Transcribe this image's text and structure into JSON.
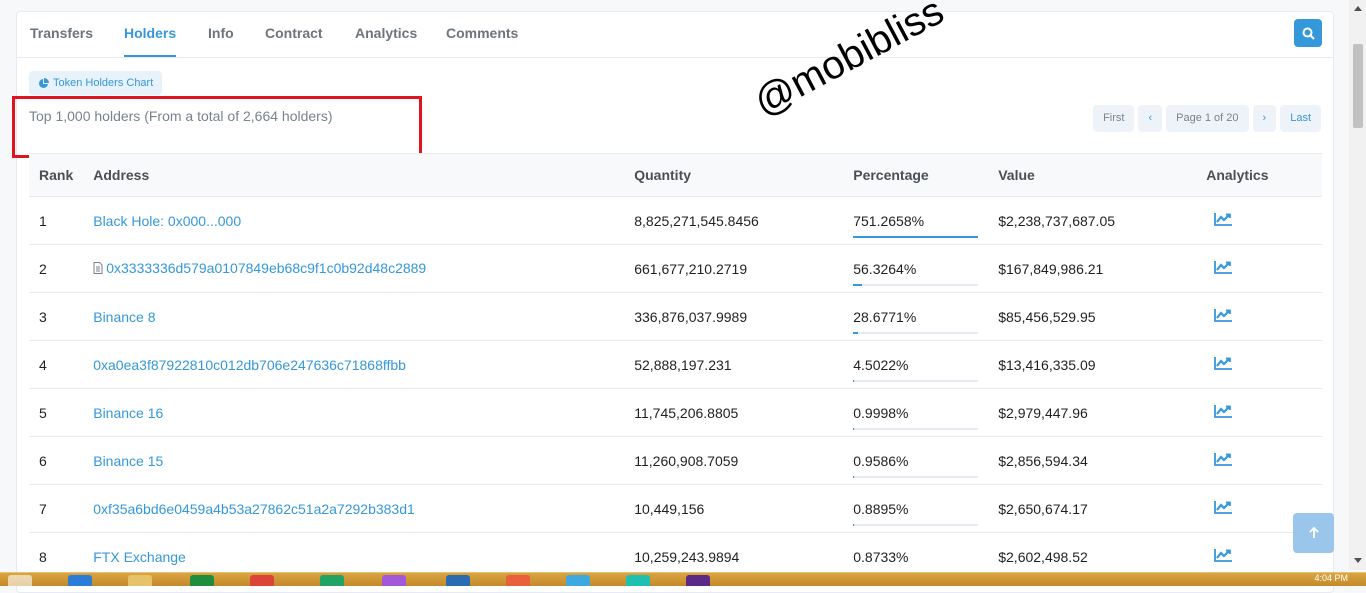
{
  "tabs": [
    {
      "label": "Transfers",
      "active": false
    },
    {
      "label": "Holders",
      "active": true
    },
    {
      "label": "Info",
      "active": false
    },
    {
      "label": "Contract",
      "active": false
    },
    {
      "label": "Analytics",
      "active": false
    },
    {
      "label": "Comments",
      "active": false
    }
  ],
  "chart_button_label": "Token Holders Chart",
  "summary": "Top 1,000 holders (From a total of 2,664 holders)",
  "watermark": "@mobibliss",
  "pagination": {
    "first": "First",
    "prev": "‹",
    "page_label": "Page 1 of 20",
    "next": "›",
    "last": "Last"
  },
  "table": {
    "headers": [
      "Rank",
      "Address",
      "Quantity",
      "Percentage",
      "Value",
      "Analytics"
    ],
    "rows": [
      {
        "rank": "1",
        "address": "Black Hole: 0x000...000",
        "is_contract": false,
        "quantity": "8,825,271,545.8456",
        "percentage": "751.2658%",
        "pct_fill": 1.0,
        "value": "$2,238,737,687.05"
      },
      {
        "rank": "2",
        "address": "0x3333336d579a0107849eb68c9f1c0b92d48c2889",
        "is_contract": true,
        "quantity": "661,677,210.2719",
        "percentage": "56.3264%",
        "pct_fill": 0.07,
        "value": "$167,849,986.21"
      },
      {
        "rank": "3",
        "address": "Binance 8",
        "is_contract": false,
        "quantity": "336,876,037.9989",
        "percentage": "28.6771%",
        "pct_fill": 0.04,
        "value": "$85,456,529.95"
      },
      {
        "rank": "4",
        "address": "0xa0ea3f87922810c012db706e247636c71868ffbb",
        "is_contract": false,
        "quantity": "52,888,197.231",
        "percentage": "4.5022%",
        "pct_fill": 0.01,
        "value": "$13,416,335.09"
      },
      {
        "rank": "5",
        "address": "Binance 16",
        "is_contract": false,
        "quantity": "11,745,206.8805",
        "percentage": "0.9998%",
        "pct_fill": 0.005,
        "value": "$2,979,447.96"
      },
      {
        "rank": "6",
        "address": "Binance 15",
        "is_contract": false,
        "quantity": "11,260,908.7059",
        "percentage": "0.9586%",
        "pct_fill": 0.005,
        "value": "$2,856,594.34"
      },
      {
        "rank": "7",
        "address": "0xf35a6bd6e0459a4b53a27862c51a2a7292b383d1",
        "is_contract": false,
        "quantity": "10,449,156",
        "percentage": "0.8895%",
        "pct_fill": 0.005,
        "value": "$2,650,674.17"
      },
      {
        "rank": "8",
        "address": "FTX Exchange",
        "is_contract": false,
        "quantity": "10,259,243.9894",
        "percentage": "0.8733%",
        "pct_fill": 0.005,
        "value": "$2,602,498.52"
      }
    ]
  },
  "colors": {
    "accent": "#3498db",
    "annotation_red": "#e0141e"
  },
  "clock": "4:04 PM"
}
